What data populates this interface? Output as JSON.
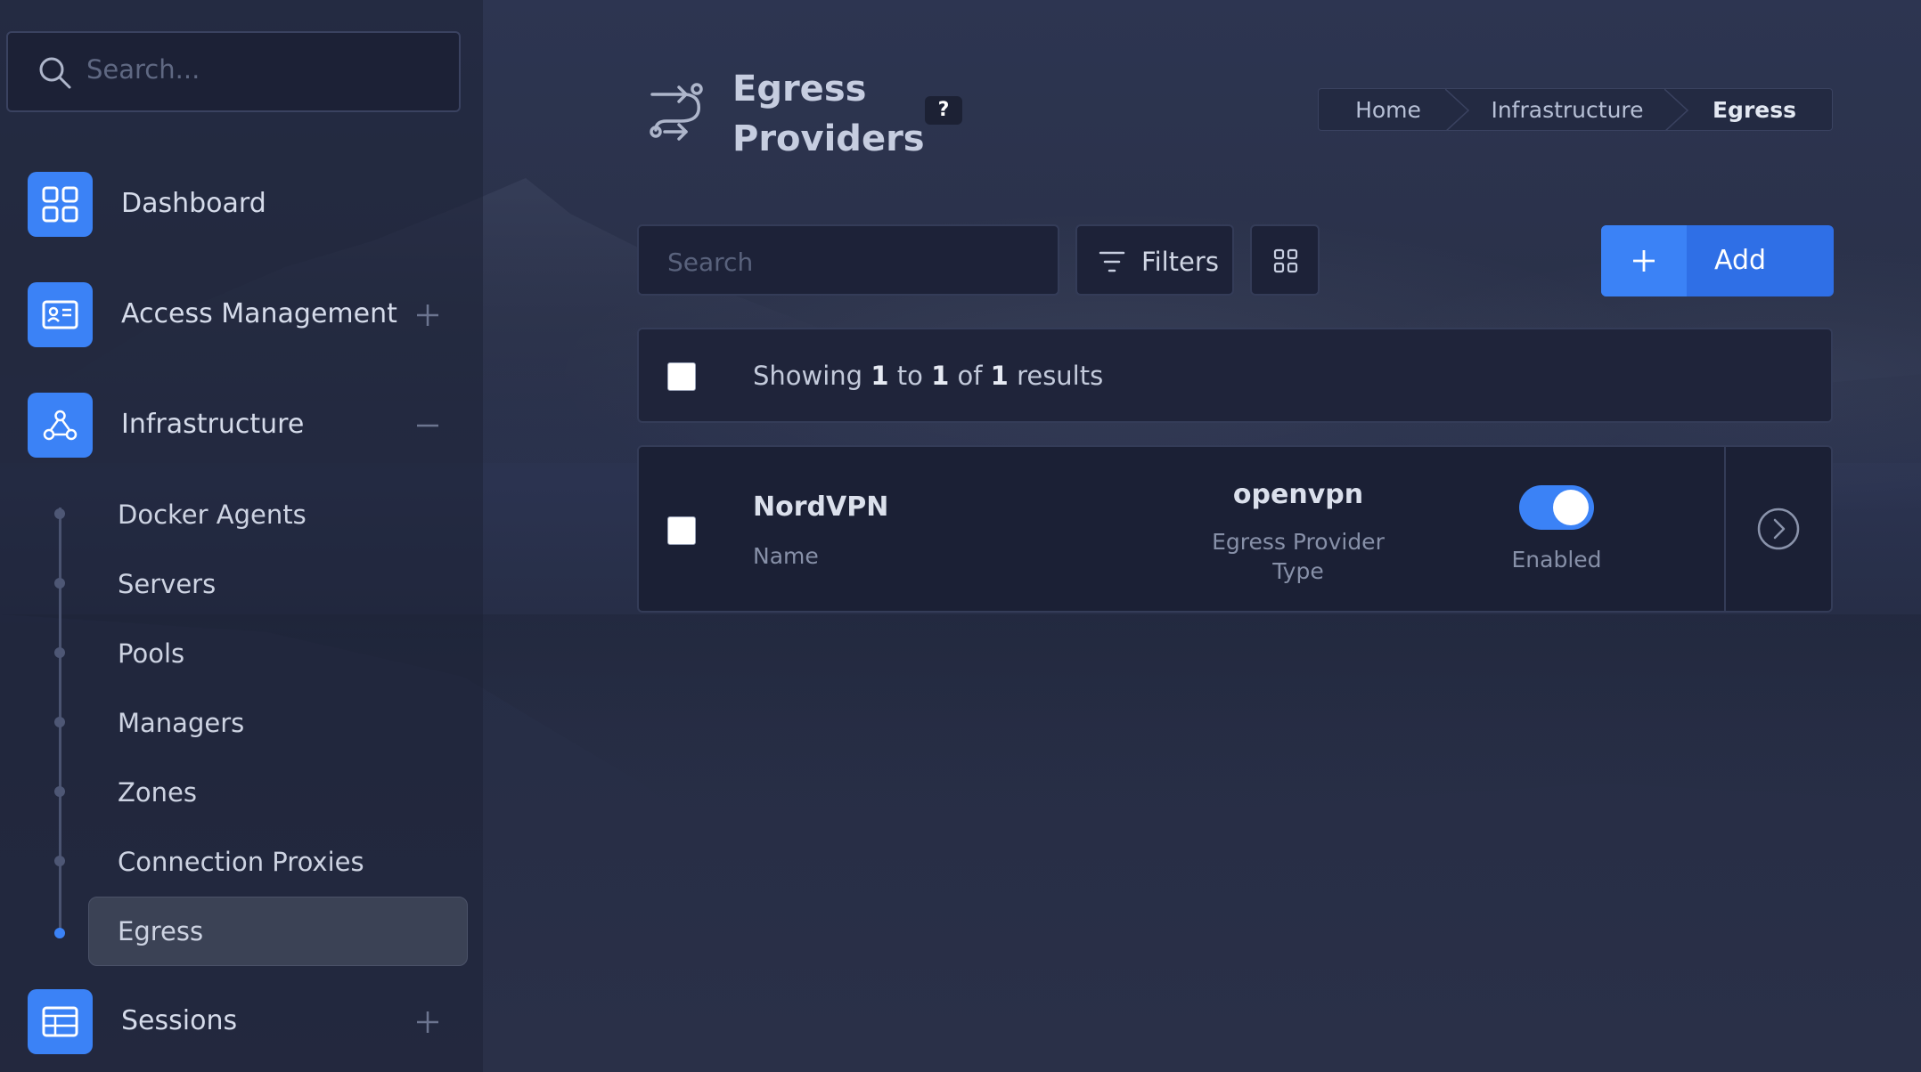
{
  "sidebar": {
    "search_placeholder": "Search...",
    "items": [
      {
        "label": "Dashboard",
        "icon": "dashboard-icon"
      },
      {
        "label": "Access Management",
        "icon": "id-card-icon",
        "toggle": "expand"
      },
      {
        "label": "Infrastructure",
        "icon": "network-icon",
        "toggle": "collapse"
      },
      {
        "label": "Sessions",
        "icon": "table-icon",
        "toggle": "expand"
      }
    ],
    "infrastructure_children": [
      {
        "label": "Docker Agents"
      },
      {
        "label": "Servers"
      },
      {
        "label": "Pools"
      },
      {
        "label": "Managers"
      },
      {
        "label": "Zones"
      },
      {
        "label": "Connection Proxies"
      },
      {
        "label": "Egress",
        "active": true
      }
    ]
  },
  "header": {
    "title": "Egress Providers",
    "help_label": "?",
    "icon": "route-icon",
    "breadcrumb": [
      "Home",
      "Infrastructure",
      "Egress"
    ]
  },
  "toolbar": {
    "search_placeholder": "Search",
    "filters_label": "Filters",
    "view_icon": "grid-view-icon",
    "add_label": "Add"
  },
  "results": {
    "prefix": "Showing",
    "from": "1",
    "to_word": "to",
    "to": "1",
    "of_word": "of",
    "total": "1",
    "suffix": "results"
  },
  "rows": [
    {
      "name": "NordVPN",
      "name_label": "Name",
      "type": "openvpn",
      "type_label": "Egress Provider Type",
      "status_label": "Enabled",
      "enabled": true
    }
  ],
  "colors": {
    "accent": "#3b82f6",
    "background": "#2a3149",
    "panel": "#1b2035"
  }
}
